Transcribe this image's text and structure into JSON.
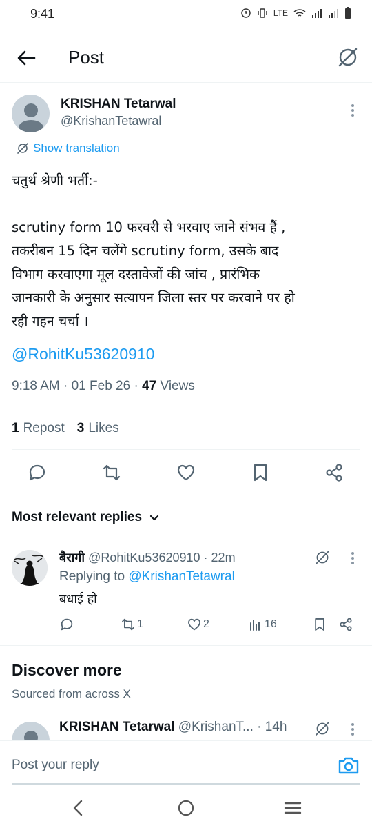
{
  "status_bar": {
    "time": "9:41",
    "network": "LTE"
  },
  "header": {
    "title": "Post"
  },
  "post": {
    "author_name": "KRISHAN Tetarwal",
    "author_handle": "@KrishanTetawral",
    "show_translation": "Show translation",
    "lines": [
      "चतुर्थ श्रेणी भर्ती:-",
      "",
      "scrutiny form 10 फरवरी से भरवाए जाने संभव हैं ,",
      "तकरीबन 15 दिन चलेंगे scrutiny form, उसके बाद",
      "विभाग करवाएगा मूल दस्तावेजों की जांच , प्रारंभिक",
      "जानकारी के अनुसार सत्यापन जिला स्तर पर करवाने पर हो",
      "रही गहन चर्चा ।"
    ],
    "mention": "@RohitKu53620910",
    "time": "9:18 AM",
    "date": "01 Feb 26",
    "views_count": "47",
    "views_label": "Views",
    "reposts_count": "1",
    "reposts_label": "Repost",
    "likes_count": "3",
    "likes_label": "Likes"
  },
  "replies": {
    "sort_label": "Most relevant replies",
    "items": [
      {
        "name": "बैरागी",
        "handle": "@RohitKu53620910",
        "age": "22m",
        "replying_prefix": "Replying to",
        "replying_to": "@KrishanTetawral",
        "text": "बधाई हो",
        "reposts": "1",
        "likes": "2",
        "views": "16"
      }
    ]
  },
  "discover": {
    "title": "Discover more",
    "subtitle": "Sourced from across X",
    "next": {
      "name": "KRISHAN Tetarwal",
      "handle": "@KrishanT...",
      "age": "14h"
    }
  },
  "reply_bar": {
    "placeholder": "Post your reply"
  },
  "colors": {
    "accent": "#1d9bf0",
    "text": "#0f1419",
    "secondary": "#536471",
    "divider": "#eff3f4"
  }
}
